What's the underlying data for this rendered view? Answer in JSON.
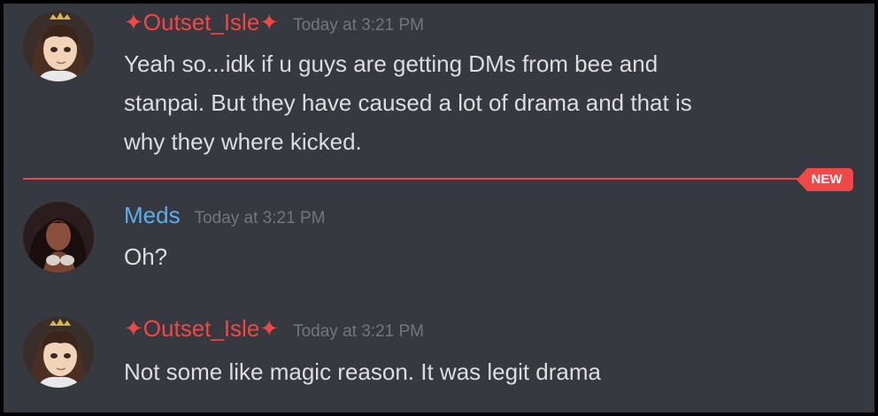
{
  "colors": {
    "background": "#36393f",
    "username_outset": "#f04747",
    "username_meds": "#5dadec",
    "timestamp": "#72767d",
    "message_text": "#dcddde",
    "new_divider": "#f04747"
  },
  "messages": [
    {
      "author": "✦Outset_Isle✦",
      "timestamp": "Today at 3:21 PM",
      "lines": [
        "Yeah so...idk if u guys are getting DMs from bee and",
        "stanpai. But they have caused a lot of drama and that is",
        "why they where kicked."
      ],
      "avatar_icon": "anime-avatar-crown-icon"
    },
    {
      "author": "Meds",
      "timestamp": "Today at 3:21 PM",
      "lines": [
        "Oh?"
      ],
      "avatar_icon": "dark-portrait-avatar-icon"
    },
    {
      "author": "✦Outset_Isle✦",
      "timestamp": "Today at 3:21 PM",
      "lines": [
        "Not some like magic reason. It was legit drama"
      ],
      "avatar_icon": "anime-avatar-crown-icon"
    }
  ],
  "new_divider": {
    "label": "NEW"
  }
}
